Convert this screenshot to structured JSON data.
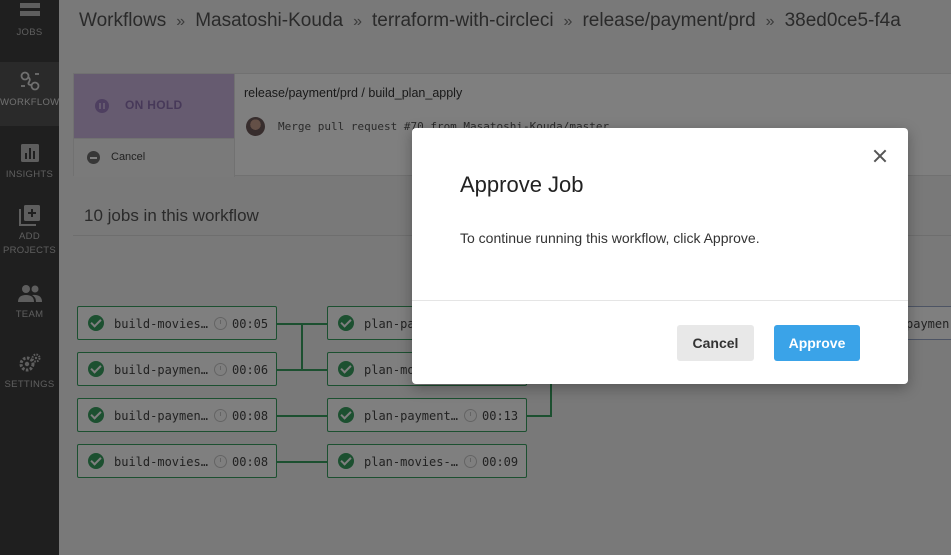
{
  "sidebar": {
    "items": [
      {
        "label": "JOBS",
        "icon": "jobs-icon"
      },
      {
        "label": "WORKFLOWS",
        "icon": "workflows-icon",
        "active": true
      },
      {
        "label": "INSIGHTS",
        "icon": "insights-icon"
      },
      {
        "label": "ADD PROJECTS",
        "icon": "add-projects-icon"
      },
      {
        "label": "TEAM",
        "icon": "team-icon"
      },
      {
        "label": "SETTINGS",
        "icon": "settings-icon"
      }
    ]
  },
  "breadcrumb": {
    "items": [
      "Workflows",
      "Masatoshi-Kouda",
      "terraform-with-circleci",
      "release/payment/prd",
      "38ed0ce5-f4a"
    ],
    "separator": "»"
  },
  "workflow": {
    "status": "ON HOLD",
    "cancel_label": "Cancel",
    "job_path": "release/payment/prd / build_plan_apply",
    "commit_message": "Merge pull request #70 from Masatoshi-Kouda/master"
  },
  "jobs_heading": "10 jobs in this workflow",
  "jobs": [
    {
      "name": "build-movies-prd",
      "display": "build-movies…",
      "duration": "00:05"
    },
    {
      "name": "build-payment-prd",
      "display": "build-paymen…",
      "duration": "00:06"
    },
    {
      "name": "build-payment-prd",
      "display": "build-paymen…",
      "duration": "00:08"
    },
    {
      "name": "build-movies-prd",
      "display": "build-movies…",
      "duration": "00:08"
    },
    {
      "name": "plan-payment",
      "display": "plan-pa",
      "duration": ""
    },
    {
      "name": "plan-movies",
      "display": "plan-mo",
      "duration": ""
    },
    {
      "name": "plan-payment",
      "display": "plan-payment…",
      "duration": "00:13"
    },
    {
      "name": "plan-movies",
      "display": "plan-movies-…",
      "duration": "00:09"
    },
    {
      "name": "apply-payment",
      "display": "paymen",
      "duration": ""
    }
  ],
  "modal": {
    "title": "Approve Job",
    "body": "To continue running this workflow, click Approve.",
    "cancel_label": "Cancel",
    "approve_label": "Approve"
  },
  "colors": {
    "sidebar_bg": "#3f3f3f",
    "on_hold": "#ccb6e0",
    "success_green": "#39a061",
    "approve_blue": "#3aa3e8"
  }
}
